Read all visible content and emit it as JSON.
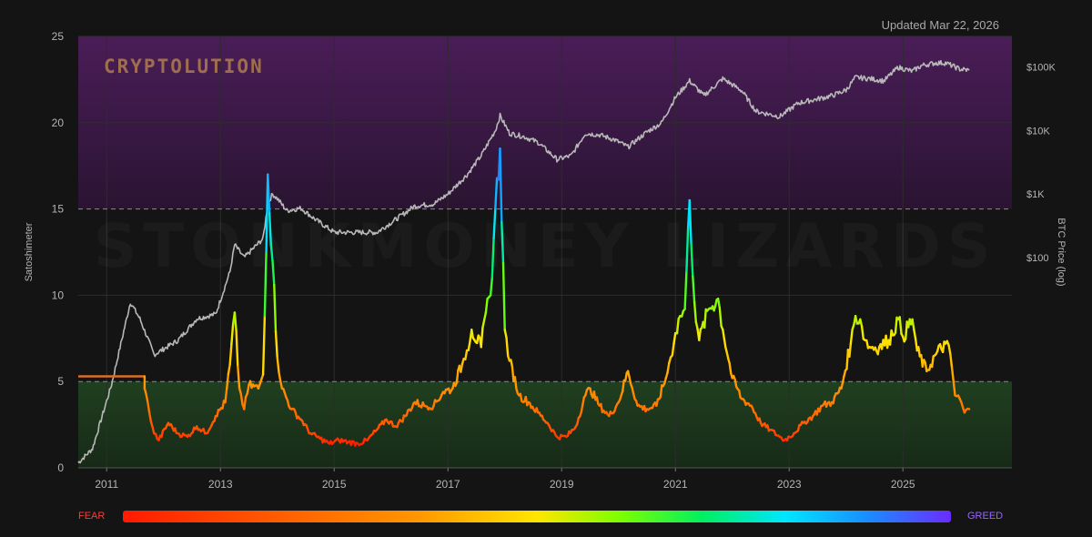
{
  "header": {
    "updated": "Updated Mar 22, 2026"
  },
  "logo": "CRYPTOLUTION",
  "watermark": "STONKMONEY LIZARDS",
  "legend": {
    "fear": "FEAR",
    "greed": "GREED"
  },
  "colors": {
    "background": "#141414",
    "greed_zone": "#3a1a45",
    "fear_zone": "#1c3a1c",
    "price_line": "#b8b8b8",
    "threshold_line": "#8a8a8a"
  },
  "chart_data": {
    "type": "line",
    "title": "",
    "xlabel": "",
    "ylabel": "Satoshimeter",
    "y2label": "BTC Price (log)",
    "x_ticks": [
      "2011",
      "2013",
      "2015",
      "2017",
      "2019",
      "2021",
      "2023",
      "2025"
    ],
    "y_ticks": [
      0,
      5,
      10,
      15,
      20,
      25
    ],
    "y2_ticks": [
      "$100",
      "$1K",
      "$10K",
      "$100K"
    ],
    "xlim": [
      "2010-07",
      "2026-12"
    ],
    "ylim": [
      0,
      25
    ],
    "y2lim": [
      0.05,
      300000
    ],
    "y2_scale": "log",
    "zones": [
      {
        "from": 15,
        "to": 25,
        "label": "greed zone",
        "color": "#3a1a45"
      },
      {
        "from": 0,
        "to": 5,
        "label": "fear zone",
        "color": "#1c3a1c"
      }
    ],
    "thresholds": [
      5,
      15
    ],
    "color_scale": {
      "low": "FEAR",
      "high": "GREED"
    },
    "series": [
      {
        "axis": "left",
        "color": "gradient",
        "x": [
          "2010-07",
          "2011-09",
          "2011-09",
          "2011-10",
          "2011-11",
          "2011-12",
          "2012-02",
          "2012-04",
          "2012-06",
          "2012-08",
          "2012-10",
          "2012-12",
          "2013-02",
          "2013-03",
          "2013-04",
          "2013-05",
          "2013-06",
          "2013-07",
          "2013-09",
          "2013-10",
          "2013-11",
          "2013-12",
          "2014-01",
          "2014-02",
          "2014-04",
          "2014-06",
          "2014-08",
          "2014-10",
          "2014-12",
          "2015-02",
          "2015-04",
          "2015-06",
          "2015-08",
          "2015-10",
          "2015-12",
          "2016-02",
          "2016-04",
          "2016-06",
          "2016-08",
          "2016-10",
          "2016-12",
          "2017-02",
          "2017-04",
          "2017-05",
          "2017-06",
          "2017-08",
          "2017-09",
          "2017-10",
          "2017-11",
          "2017-12",
          "2018-01",
          "2018-02",
          "2018-04",
          "2018-06",
          "2018-08",
          "2018-10",
          "2018-12",
          "2019-02",
          "2019-04",
          "2019-06",
          "2019-07",
          "2019-09",
          "2019-11",
          "2020-01",
          "2020-03",
          "2020-05",
          "2020-07",
          "2020-09",
          "2020-11",
          "2020-12",
          "2021-01",
          "2021-02",
          "2021-03",
          "2021-04",
          "2021-05",
          "2021-06",
          "2021-08",
          "2021-10",
          "2021-11",
          "2022-01",
          "2022-03",
          "2022-05",
          "2022-07",
          "2022-09",
          "2022-11",
          "2022-12",
          "2023-02",
          "2023-04",
          "2023-06",
          "2023-08",
          "2023-10",
          "2023-12",
          "2024-02",
          "2024-03",
          "2024-04",
          "2024-05",
          "2024-06",
          "2024-08",
          "2024-10",
          "2024-12",
          "2025-01",
          "2025-03",
          "2025-04",
          "2025-06",
          "2025-08",
          "2025-10",
          "2025-11",
          "2025-12",
          "2026-01",
          "2026-02",
          "2026-03"
        ],
        "values": [
          5.3,
          5.3,
          4.6,
          3.2,
          2.0,
          1.6,
          2.6,
          2.0,
          1.8,
          2.4,
          2.0,
          3.0,
          3.8,
          6.0,
          9.0,
          4.6,
          3.4,
          4.8,
          4.6,
          5.4,
          17.0,
          12.0,
          6.4,
          4.6,
          3.4,
          2.8,
          2.0,
          1.7,
          1.4,
          1.6,
          1.5,
          1.4,
          1.6,
          2.2,
          2.8,
          2.4,
          3.0,
          3.8,
          3.6,
          3.6,
          4.4,
          4.6,
          6.0,
          6.8,
          8.0,
          7.0,
          9.0,
          10.0,
          15.0,
          18.5,
          8.0,
          6.2,
          4.2,
          3.8,
          3.2,
          2.6,
          1.8,
          1.8,
          2.4,
          4.2,
          4.6,
          3.6,
          3.0,
          3.8,
          5.6,
          3.6,
          3.4,
          3.6,
          5.2,
          6.4,
          7.8,
          8.8,
          9.2,
          15.5,
          9.6,
          7.4,
          9.2,
          9.8,
          8.0,
          5.2,
          4.0,
          3.6,
          2.6,
          2.2,
          1.8,
          1.6,
          2.0,
          2.6,
          3.0,
          3.6,
          3.8,
          4.6,
          7.2,
          8.8,
          8.6,
          7.4,
          7.0,
          7.0,
          7.4,
          8.6,
          7.6,
          8.6,
          6.8,
          5.6,
          6.6,
          7.2,
          6.6,
          4.2,
          4.0,
          3.2,
          3.4
        ]
      },
      {
        "axis": "right",
        "name": "BTC Price",
        "color": "#b8b8b8",
        "x": [
          "2010-07",
          "2010-10",
          "2011-02",
          "2011-06",
          "2011-08",
          "2011-11",
          "2012-04",
          "2012-08",
          "2012-12",
          "2013-03",
          "2013-04",
          "2013-06",
          "2013-10",
          "2013-11",
          "2013-12",
          "2014-01",
          "2014-03",
          "2014-06",
          "2014-09",
          "2015-01",
          "2015-06",
          "2015-10",
          "2016-02",
          "2016-06",
          "2016-10",
          "2017-01",
          "2017-05",
          "2017-08",
          "2017-11",
          "2017-12",
          "2018-02",
          "2018-05",
          "2018-08",
          "2018-12",
          "2019-03",
          "2019-06",
          "2019-09",
          "2019-12",
          "2020-03",
          "2020-07",
          "2020-10",
          "2021-01",
          "2021-04",
          "2021-07",
          "2021-11",
          "2022-03",
          "2022-06",
          "2022-11",
          "2023-03",
          "2023-06",
          "2023-10",
          "2024-01",
          "2024-03",
          "2024-06",
          "2024-09",
          "2024-12",
          "2025-03",
          "2025-05",
          "2025-08",
          "2025-10",
          "2026-01",
          "2026-03"
        ],
        "values": [
          0.06,
          0.1,
          1.0,
          20,
          11,
          3,
          5,
          11,
          13,
          60,
          160,
          100,
          200,
          700,
          1000,
          850,
          550,
          600,
          400,
          250,
          250,
          250,
          400,
          650,
          700,
          1000,
          2000,
          4000,
          10000,
          17000,
          9000,
          8000,
          6500,
          3500,
          4000,
          9000,
          8500,
          7200,
          5500,
          9500,
          13000,
          33000,
          60000,
          35000,
          65000,
          42000,
          20000,
          16500,
          27000,
          30000,
          35000,
          43000,
          68000,
          65000,
          60000,
          98000,
          85000,
          105000,
          115000,
          115000,
          92000,
          88000
        ]
      }
    ]
  }
}
